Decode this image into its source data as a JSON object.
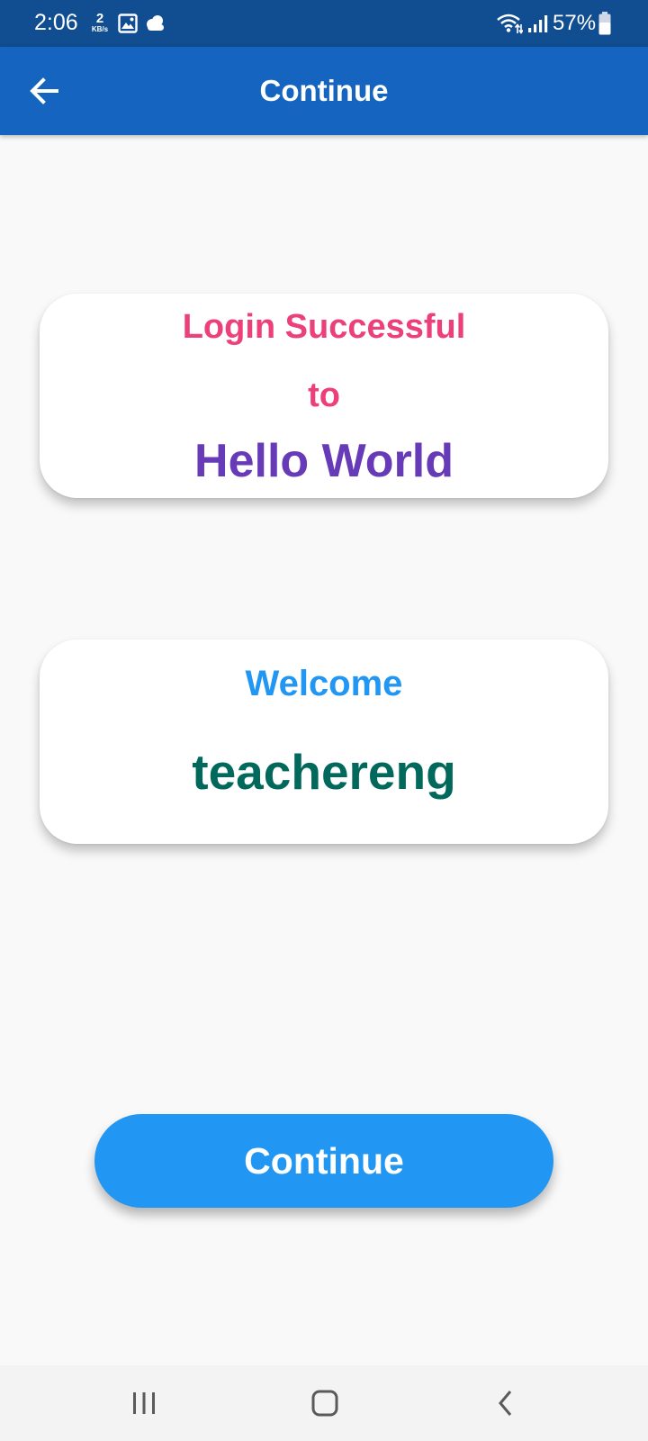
{
  "status_bar": {
    "time": "2:06",
    "net_speed_value": "2",
    "net_speed_unit": "KB/s",
    "battery": "57%",
    "icons": [
      "gallery-icon",
      "cloud-icon",
      "wifi-icon",
      "signal-icon",
      "battery-icon"
    ]
  },
  "app_bar": {
    "back_icon": "arrow-left-icon",
    "title": "Continue"
  },
  "login_card": {
    "line1": "Login Successful",
    "line2": "to",
    "app_name": "Hello World"
  },
  "welcome_card": {
    "greeting": "Welcome",
    "username": "teachereng"
  },
  "continue_button": {
    "label": "Continue"
  },
  "nav_bar": {
    "icons": [
      "recents-icon",
      "home-icon",
      "back-icon"
    ]
  },
  "colors": {
    "status_bar": "#104d91",
    "app_bar": "#1565c0",
    "background": "#f9f9f9",
    "pink": "#ec407a",
    "purple": "#673ab7",
    "blue": "#2196f3",
    "teal": "#00695c"
  }
}
